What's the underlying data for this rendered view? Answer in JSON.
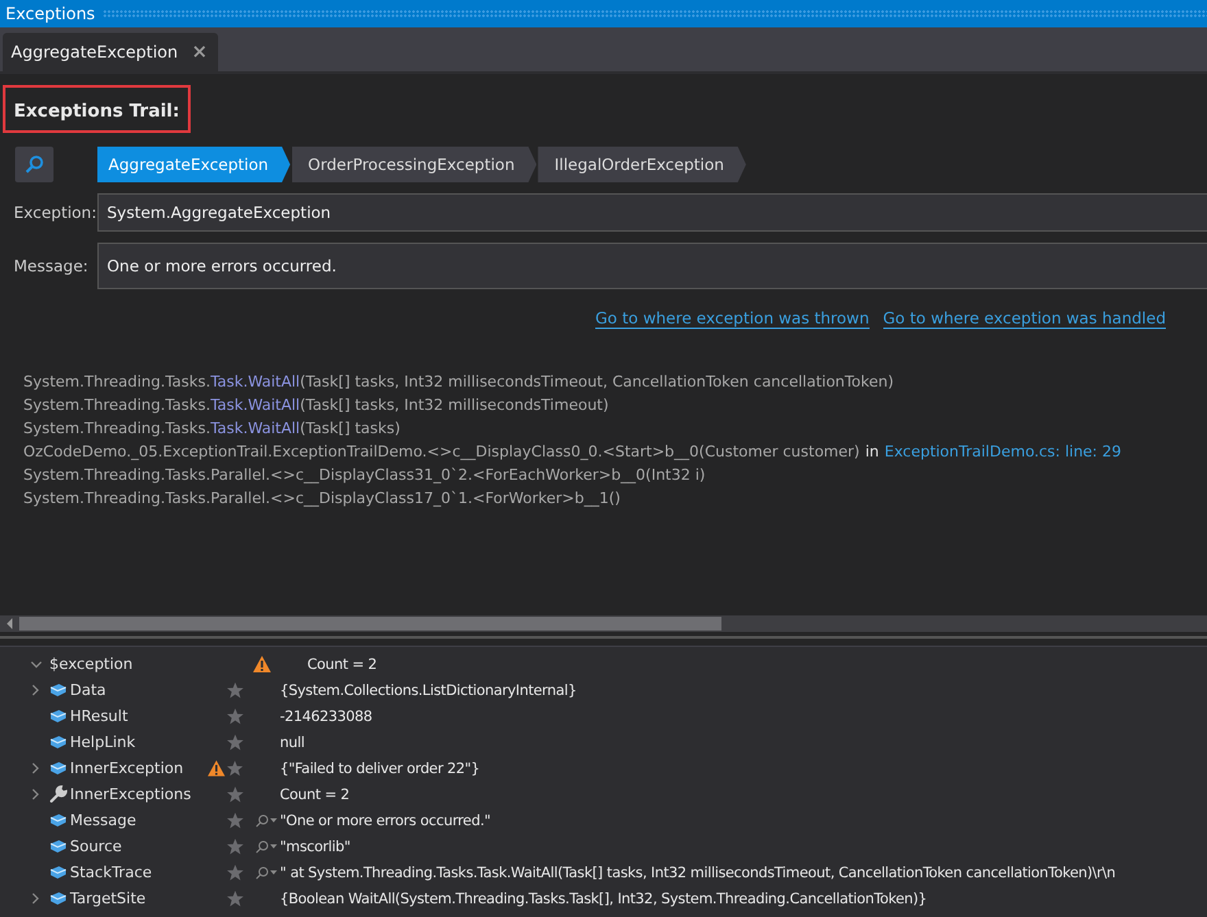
{
  "window": {
    "title": "Exceptions"
  },
  "tabs": [
    {
      "label": "AggregateException",
      "selected": true,
      "close": "×"
    }
  ],
  "heading": "Exceptions Trail:",
  "trail": [
    {
      "label": "AggregateException",
      "selected": true
    },
    {
      "label": "OrderProcessingException",
      "selected": false
    },
    {
      "label": "IllegalOrderException",
      "selected": false
    }
  ],
  "fields": [
    {
      "label": "Exception:",
      "value": "System.AggregateException"
    },
    {
      "label": "Message:",
      "value": "One or more errors occurred."
    }
  ],
  "links": [
    "Go to where exception was thrown",
    "Go to where exception was handled"
  ],
  "stack_trace": [
    {
      "segments": [
        {
          "kind": "plain",
          "text": "System.Threading.Tasks."
        },
        {
          "kind": "method",
          "text": "Task.WaitAll"
        },
        {
          "kind": "plain",
          "text": "(Task[] tasks, Int32 millisecondsTimeout, CancellationToken cancellationToken)"
        }
      ]
    },
    {
      "segments": [
        {
          "kind": "plain",
          "text": "System.Threading.Tasks."
        },
        {
          "kind": "method",
          "text": "Task.WaitAll"
        },
        {
          "kind": "plain",
          "text": "(Task[] tasks, Int32 millisecondsTimeout)"
        }
      ]
    },
    {
      "segments": [
        {
          "kind": "plain",
          "text": "System.Threading.Tasks."
        },
        {
          "kind": "method",
          "text": "Task.WaitAll"
        },
        {
          "kind": "plain",
          "text": "(Task[] tasks)"
        }
      ]
    },
    {
      "segments": [
        {
          "kind": "plain",
          "text": "OzCodeDemo._05.ExceptionTrail.ExceptionTrailDemo.<>c__DisplayClass0_0.<Start>b__0(Customer customer)"
        },
        {
          "kind": "in",
          "text": "in"
        },
        {
          "kind": "file",
          "text": "ExceptionTrailDemo.cs: line: 29"
        }
      ]
    },
    {
      "segments": [
        {
          "kind": "plain",
          "text": "System.Threading.Tasks.Parallel.<>c__DisplayClass31_0`2.<ForEachWorker>b__0(Int32 i)"
        }
      ]
    },
    {
      "segments": [
        {
          "kind": "plain",
          "text": "System.Threading.Tasks.Parallel.<>c__DisplayClass17_0`1.<ForWorker>b__1()"
        }
      ]
    }
  ],
  "watch": {
    "root": {
      "name": "$exception",
      "expanded": true,
      "warning": true,
      "value": "Count = 2",
      "children": [
        {
          "name": "Data",
          "kind": "property",
          "expandable": true,
          "warning": false,
          "search": false,
          "value": "{System.Collections.ListDictionaryInternal}"
        },
        {
          "name": "HResult",
          "kind": "property",
          "expandable": false,
          "warning": false,
          "search": false,
          "value": "-2146233088"
        },
        {
          "name": "HelpLink",
          "kind": "property",
          "expandable": false,
          "warning": false,
          "search": false,
          "value": "null"
        },
        {
          "name": "InnerException",
          "kind": "property",
          "expandable": true,
          "warning": true,
          "search": false,
          "value": "{\"Failed to deliver order 22\"}"
        },
        {
          "name": "InnerExceptions",
          "kind": "method",
          "expandable": true,
          "warning": false,
          "search": false,
          "value": "Count = 2"
        },
        {
          "name": "Message",
          "kind": "property",
          "expandable": false,
          "warning": false,
          "search": true,
          "value": "\"One or more errors occurred.\""
        },
        {
          "name": "Source",
          "kind": "property",
          "expandable": false,
          "warning": false,
          "search": true,
          "value": "\"mscorlib\""
        },
        {
          "name": "StackTrace",
          "kind": "property",
          "expandable": false,
          "warning": false,
          "search": true,
          "value": "\"    at System.Threading.Tasks.Task.WaitAll(Task[] tasks, Int32 millisecondsTimeout, CancellationToken cancellationToken)\\r\\n"
        },
        {
          "name": "TargetSite",
          "kind": "property",
          "expandable": true,
          "warning": false,
          "search": false,
          "value": "{Boolean WaitAll(System.Threading.Tasks.Task[], Int32, System.Threading.CancellationToken)}"
        }
      ]
    }
  }
}
